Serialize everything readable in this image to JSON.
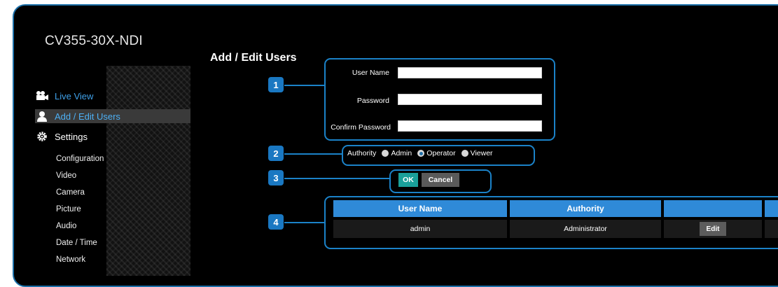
{
  "app": {
    "title": "CV355-30X-NDI"
  },
  "sidebar": {
    "main_items": [
      {
        "label": "Live View",
        "icon": "camera-icon"
      },
      {
        "label": "Add / Edit Users",
        "icon": "user-icon",
        "active": true
      },
      {
        "label": "Settings",
        "icon": "gear-icon"
      }
    ],
    "sub_items": [
      "Configuration",
      "Video",
      "Camera",
      "Picture",
      "Audio",
      "Date / Time",
      "Network"
    ]
  },
  "page": {
    "title": "Add / Edit Users"
  },
  "callouts": [
    "1",
    "2",
    "3",
    "4"
  ],
  "form": {
    "username_label": "User Name",
    "password_label": "Password",
    "confirm_label": "Confirm Password",
    "username_value": "",
    "password_value": "",
    "confirm_value": ""
  },
  "authority": {
    "label": "Authority",
    "options": [
      "Admin",
      "Operator",
      "Viewer"
    ],
    "selected": "Operator"
  },
  "buttons": {
    "ok": "OK",
    "cancel": "Cancel"
  },
  "table": {
    "headers": [
      "User Name",
      "Authority",
      ""
    ],
    "rows": [
      {
        "user": "admin",
        "authority": "Administrator",
        "action": "Edit"
      }
    ]
  },
  "colors": {
    "accent": "#1b82c8",
    "header": "#2f8ad8",
    "ok": "#1aa09a"
  }
}
